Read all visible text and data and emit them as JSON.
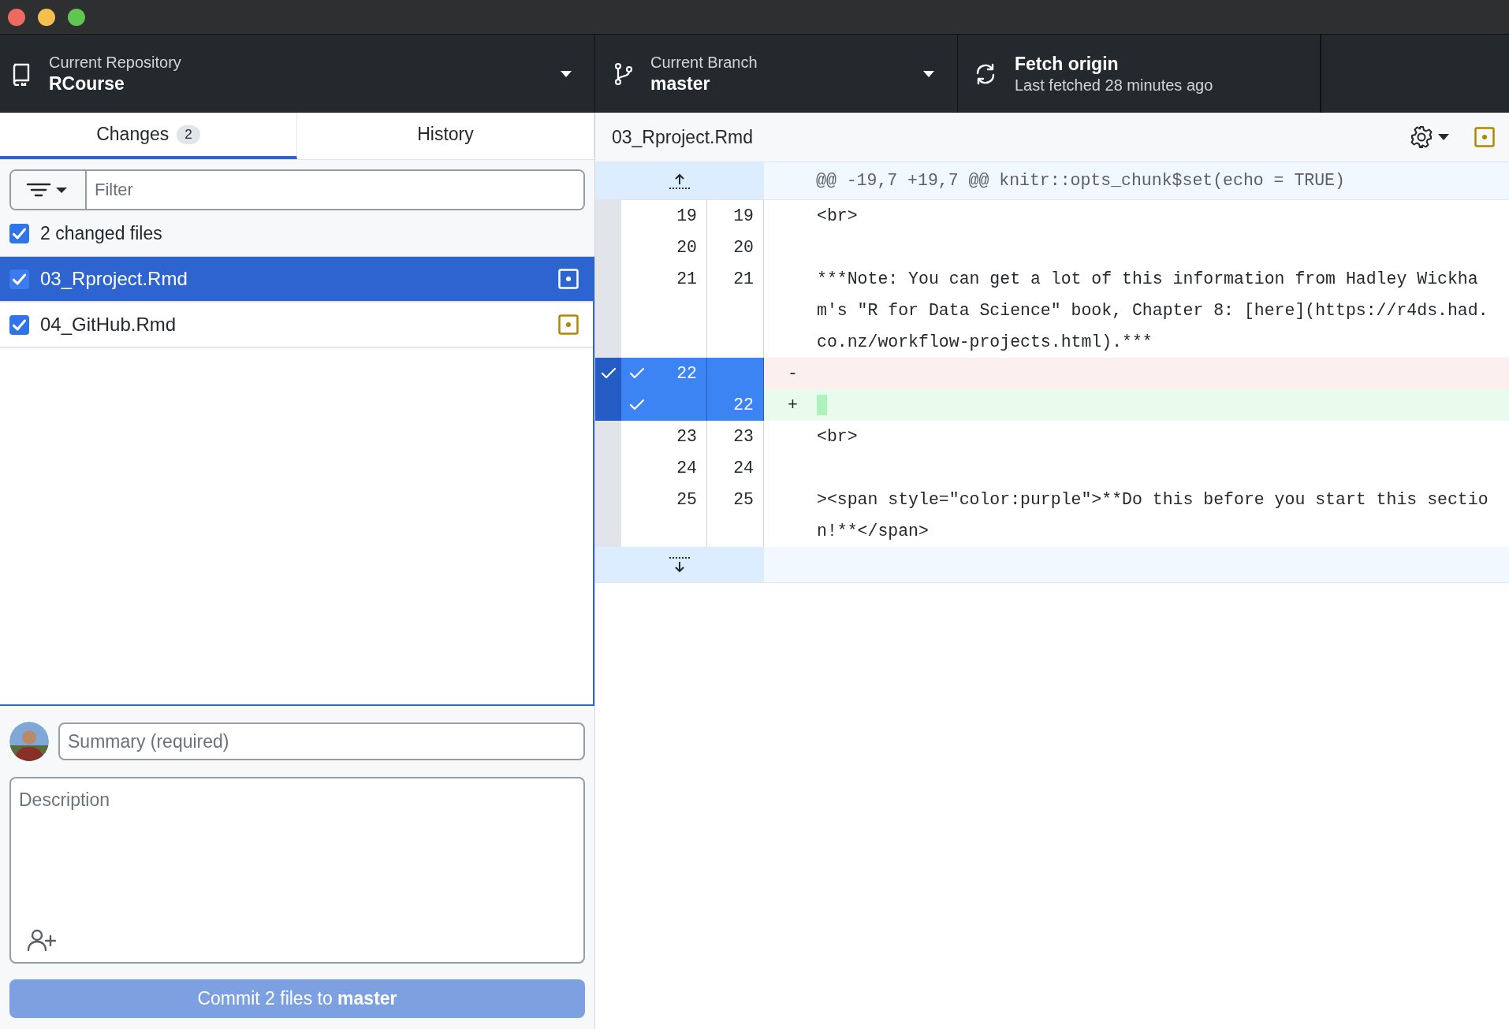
{
  "toolbar": {
    "repository": {
      "label": "Current Repository",
      "value": "RCourse"
    },
    "branch": {
      "label": "Current Branch",
      "value": "master"
    },
    "fetch": {
      "label": "Fetch origin",
      "detail": "Last fetched 28 minutes ago"
    }
  },
  "tabs": [
    {
      "label": "Changes",
      "count": "2",
      "selected": true
    },
    {
      "label": "History",
      "selected": false
    }
  ],
  "filter": {
    "placeholder": "Filter"
  },
  "changes": {
    "header": "2 changed files",
    "all_checked": true,
    "files": [
      {
        "name": "03_Rproject.Rmd",
        "checked": true,
        "selected": true
      },
      {
        "name": "04_GitHub.Rmd",
        "checked": true,
        "selected": false
      }
    ]
  },
  "commit": {
    "summary_placeholder": "Summary (required)",
    "description_placeholder": "Description",
    "button": "Commit 2 files to **master**",
    "disabled": true
  },
  "diff": {
    "file": "03_Rproject.Rmd",
    "hunk": "@@ -19,7 +19,7 @@ knitr::opts_chunk$set(echo = TRUE)",
    "lines": [
      {
        "kind": "context",
        "old": "19",
        "new": "19",
        "text": "<br>",
        "selected": false
      },
      {
        "kind": "context",
        "old": "20",
        "new": "20",
        "selected": false
      },
      {
        "kind": "context",
        "old": "21",
        "new": "21",
        "text": "***Note: You can get a lot of this information from Hadley Wickham's \"R for Data Science\" book, Chapter 8: [here](https://r4ds.had.co.nz/workflow-projects.html).***",
        "selected": false
      },
      {
        "kind": "deleted",
        "old": "22",
        "sign": "-",
        "selected": true
      },
      {
        "kind": "added",
        "new": "22",
        "sign": "+",
        "selected": true
      },
      {
        "kind": "context",
        "old": "23",
        "new": "23",
        "text": "<br>",
        "selected": false
      },
      {
        "kind": "context",
        "old": "24",
        "new": "24",
        "selected": false
      },
      {
        "kind": "context",
        "old": "25",
        "new": "25",
        "text": "><span style=\"color:purple\">**Do this before you start this section!**</span>",
        "selected": false
      }
    ]
  }
}
